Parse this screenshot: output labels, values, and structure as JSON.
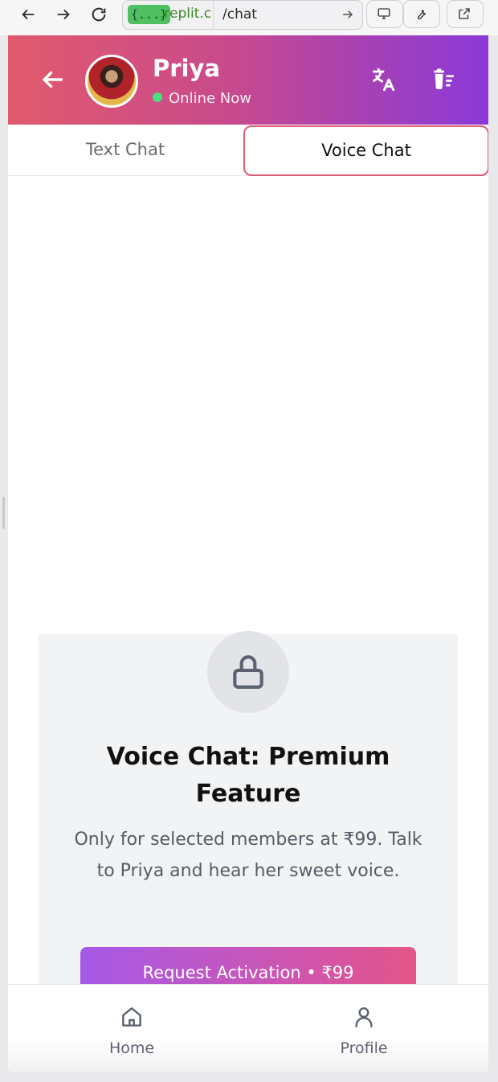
{
  "browser": {
    "url_chip": "{...}",
    "url_domain": ".replit.c",
    "url_path": "/chat",
    "icons": [
      "back-arrow-icon",
      "forward-arrow-icon",
      "reload-icon",
      "monitor-icon",
      "wrench-icon",
      "external-link-icon"
    ]
  },
  "header": {
    "name": "Priya",
    "status": "Online Now",
    "gradient_colors": [
      "#e15a6c",
      "#c94a8c",
      "#8a39d9"
    ]
  },
  "tabs": {
    "text_chat": "Text Chat",
    "voice_chat": "Voice Chat",
    "active": "Voice Chat",
    "active_border_color": "#dd5b75"
  },
  "premium": {
    "title": "Voice Chat: Premium Feature",
    "description": "Only for selected members at ₹99. Talk to Priya and hear her sweet voice.",
    "button_label": "Request Activation • ₹99"
  },
  "nav": {
    "home": "Home",
    "profile": "Profile"
  }
}
